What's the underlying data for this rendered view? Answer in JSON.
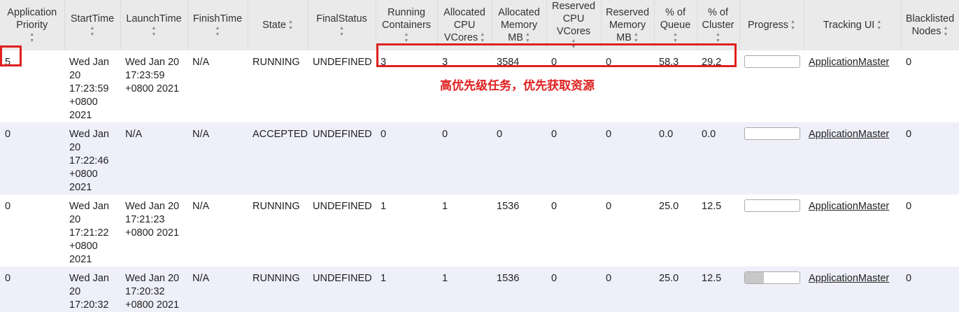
{
  "headers": [
    {
      "label": "Application Priority",
      "sort": "below"
    },
    {
      "label": "StartTime",
      "sort": "below"
    },
    {
      "label": "LaunchTime",
      "sort": "below"
    },
    {
      "label": "FinishTime",
      "sort": "below"
    },
    {
      "label": "State",
      "sort": "inline"
    },
    {
      "label": "FinalStatus",
      "sort": "below"
    },
    {
      "label": "Running Containers",
      "sort": "below"
    },
    {
      "label": "Allocated CPU VCores",
      "sort": "inline"
    },
    {
      "label": "Allocated Memory MB",
      "sort": "inline"
    },
    {
      "label": "Reserved CPU VCores",
      "sort": "below"
    },
    {
      "label": "Reserved Memory MB",
      "sort": "inline"
    },
    {
      "label": "% of Queue",
      "sort": "below"
    },
    {
      "label": "% of Cluster",
      "sort": "below"
    },
    {
      "label": "Progress",
      "sort": "inline"
    },
    {
      "label": "Tracking UI",
      "sort": "inline"
    },
    {
      "label": "Blacklisted Nodes",
      "sort": "inline"
    }
  ],
  "rows": [
    {
      "priority": "5",
      "start": "Wed Jan 20 17:23:59 +0800 2021",
      "launch": "Wed Jan 20 17:23:59 +0800 2021",
      "finish": "N/A",
      "state": "RUNNING",
      "final_status": "UNDEFINED",
      "running_containers": "3",
      "alloc_vcores": "3",
      "alloc_mem": "3584",
      "res_vcores": "0",
      "res_mem": "0",
      "pct_queue": "58.3",
      "pct_cluster": "29.2",
      "progress": 0.0,
      "tracking": "ApplicationMaster",
      "blacklisted": "0"
    },
    {
      "priority": "0",
      "start": "Wed Jan 20 17:22:46 +0800 2021",
      "launch": "N/A",
      "finish": "N/A",
      "state": "ACCEPTED",
      "final_status": "UNDEFINED",
      "running_containers": "0",
      "alloc_vcores": "0",
      "alloc_mem": "0",
      "res_vcores": "0",
      "res_mem": "0",
      "pct_queue": "0.0",
      "pct_cluster": "0.0",
      "progress": 0.0,
      "tracking": "ApplicationMaster",
      "blacklisted": "0"
    },
    {
      "priority": "0",
      "start": "Wed Jan 20 17:21:22 +0800 2021",
      "launch": "Wed Jan 20 17:21:23 +0800 2021",
      "finish": "N/A",
      "state": "RUNNING",
      "final_status": "UNDEFINED",
      "running_containers": "1",
      "alloc_vcores": "1",
      "alloc_mem": "1536",
      "res_vcores": "0",
      "res_mem": "0",
      "pct_queue": "25.0",
      "pct_cluster": "12.5",
      "progress": 0.0,
      "tracking": "ApplicationMaster",
      "blacklisted": "0"
    },
    {
      "priority": "0",
      "start": "Wed Jan 20 17:20:32",
      "launch": "Wed Jan 20 17:20:32 +0800 2021",
      "finish": "N/A",
      "state": "RUNNING",
      "final_status": "UNDEFINED",
      "running_containers": "1",
      "alloc_vcores": "1",
      "alloc_mem": "1536",
      "res_vcores": "0",
      "res_mem": "0",
      "pct_queue": "25.0",
      "pct_cluster": "12.5",
      "progress": 0.35,
      "tracking": "ApplicationMaster",
      "blacklisted": "0"
    }
  ],
  "annotation": "高优先级任务，优先获取资源",
  "colors": {
    "highlight": "#e02020",
    "header_bg": "#eaeaea",
    "odd_row_bg": "#eeeff9"
  }
}
